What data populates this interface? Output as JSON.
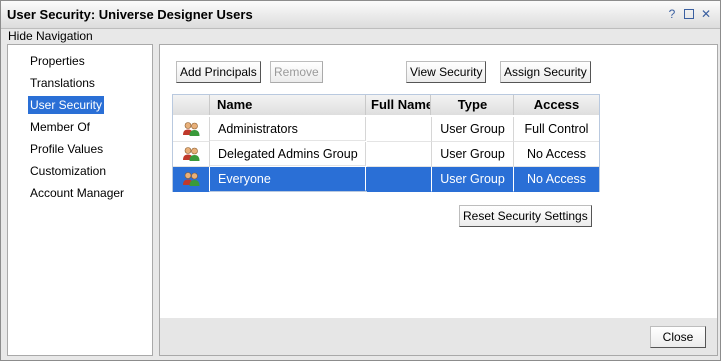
{
  "window": {
    "title": "User Security: Universe Designer Users",
    "help": "?",
    "close": "✕"
  },
  "hide_navigation": "Hide Navigation",
  "nav": {
    "items": [
      {
        "label": "Properties"
      },
      {
        "label": "Translations"
      },
      {
        "label": "User Security",
        "selected": true
      },
      {
        "label": "Member Of"
      },
      {
        "label": "Profile Values"
      },
      {
        "label": "Customization"
      },
      {
        "label": "Account Manager"
      }
    ]
  },
  "toolbar": {
    "add_principals": "Add Principals",
    "remove": "Remove",
    "view_security": "View Security",
    "assign_security": "Assign Security"
  },
  "table": {
    "columns": [
      "Name",
      "Full Name",
      "Type",
      "Access"
    ],
    "rows": [
      {
        "icon": "user-group-icon",
        "name": "Administrators",
        "full_name": "",
        "type": "User Group",
        "access": "Full Control",
        "selected": false
      },
      {
        "icon": "user-group-icon",
        "name": "Delegated Admins Group",
        "full_name": "",
        "type": "User Group",
        "access": "No Access",
        "selected": false
      },
      {
        "icon": "user-group-icon",
        "name": "Everyone",
        "full_name": "",
        "type": "User Group",
        "access": "No Access",
        "selected": true
      }
    ]
  },
  "reset_button": "Reset Security Settings",
  "close_button": "Close",
  "colors": {
    "selection": "#2a6fd6",
    "icon_red": "#c0392b",
    "icon_green": "#3a9a3a"
  }
}
